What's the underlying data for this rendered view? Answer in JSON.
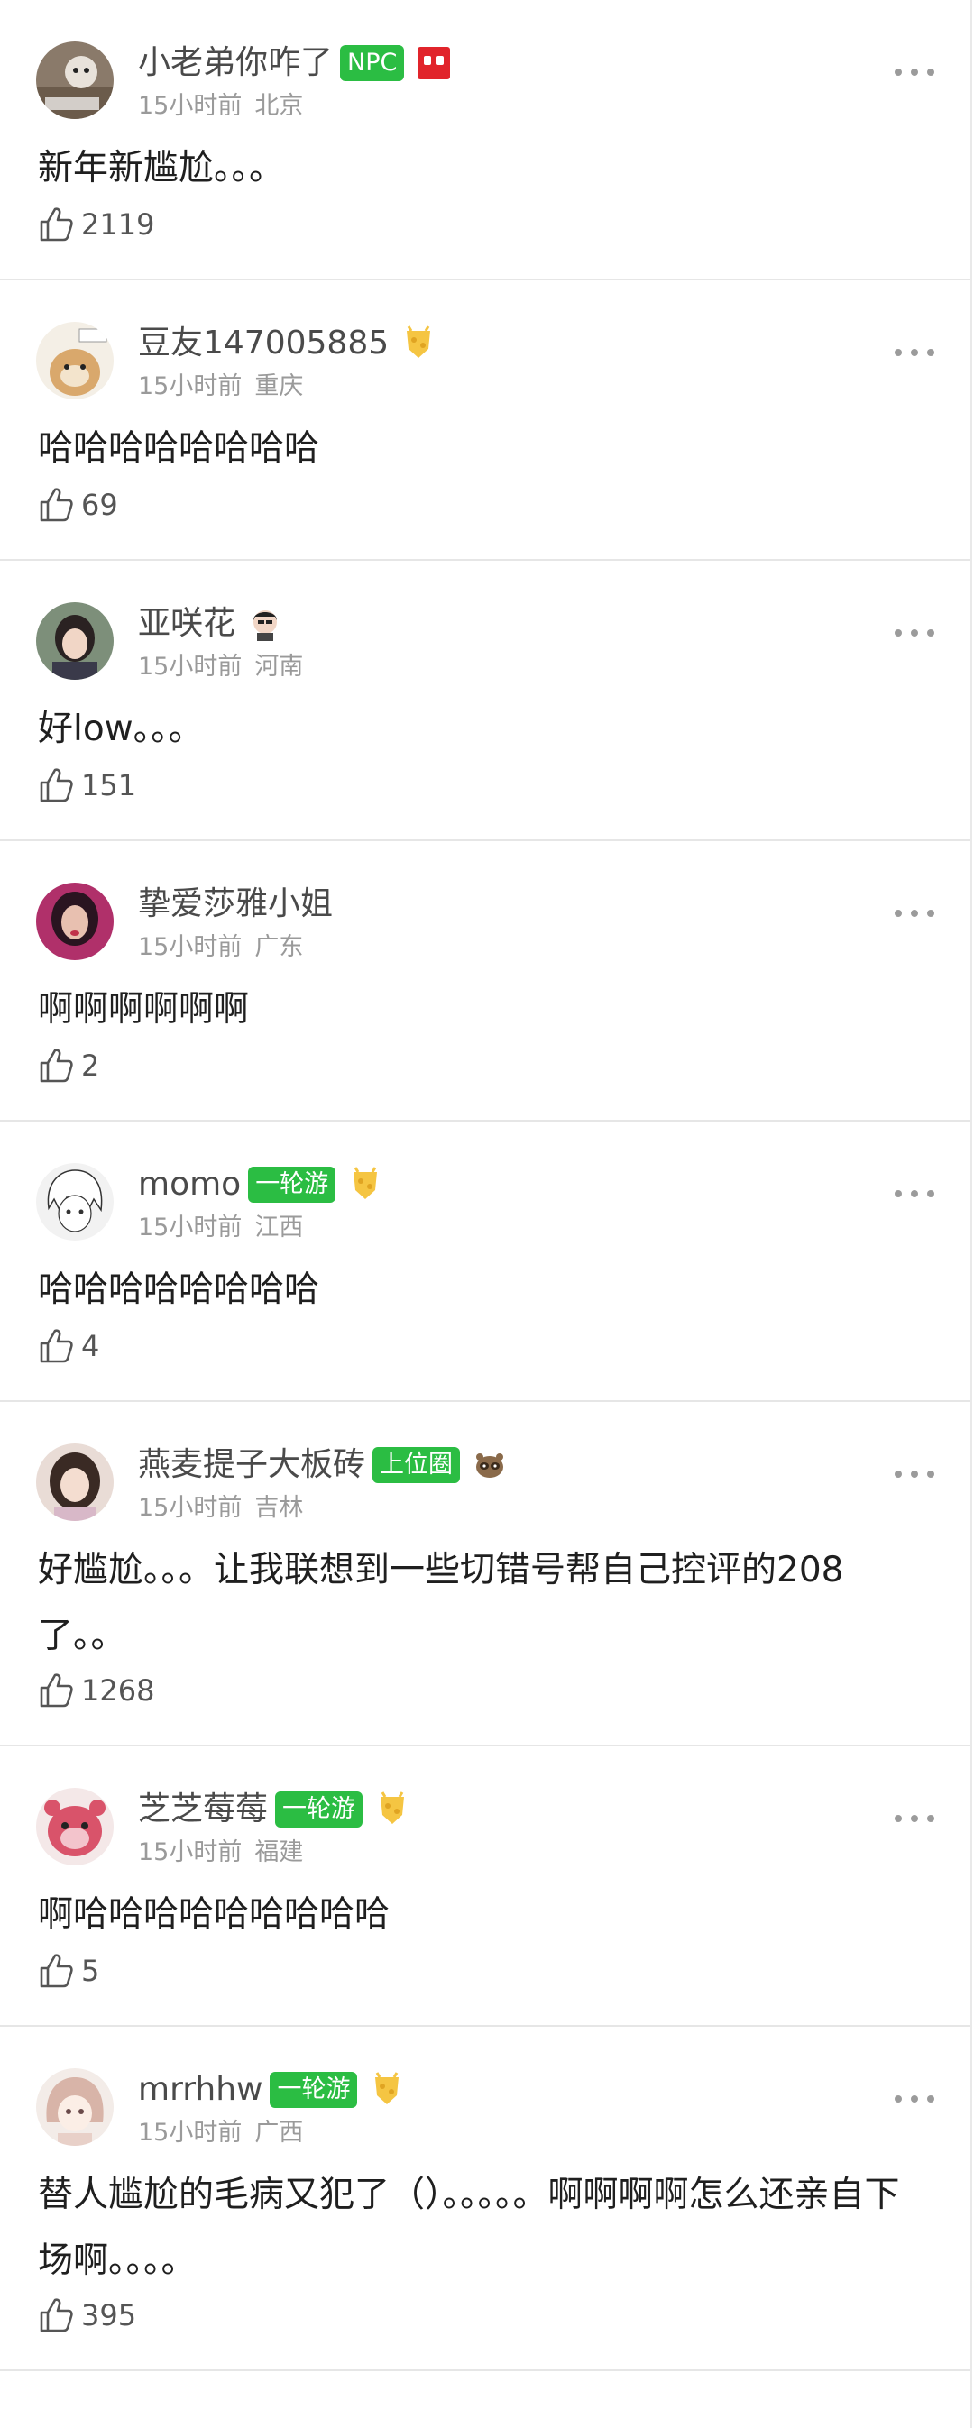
{
  "comments": [
    {
      "username": "小老弟你咋了",
      "badge": "NPC",
      "time": "15小时前",
      "location": "北京",
      "text": "新年新尴尬。。。",
      "likes": "2119",
      "badge_color": "#2bbd43"
    },
    {
      "username": "豆友147005885",
      "badge": "",
      "time": "15小时前",
      "location": "重庆",
      "text": "哈哈哈哈哈哈哈哈",
      "likes": "69"
    },
    {
      "username": "亚咲花",
      "badge": "",
      "time": "15小时前",
      "location": "河南",
      "text": "好low。。。",
      "likes": "151"
    },
    {
      "username": "挚爱莎雅小姐",
      "badge": "",
      "time": "15小时前",
      "location": "广东",
      "text": "啊啊啊啊啊啊",
      "likes": "2"
    },
    {
      "username": "momo",
      "badge": "一轮游",
      "time": "15小时前",
      "location": "江西",
      "text": "哈哈哈哈哈哈哈哈",
      "likes": "4"
    },
    {
      "username": "燕麦提子大板砖",
      "badge": "上位圈",
      "time": "15小时前",
      "location": "吉林",
      "text": "好尴尬。。。让我联想到一些切错号帮自己控评的208了。。",
      "likes": "1268"
    },
    {
      "username": "芝芝莓莓",
      "badge": "一轮游",
      "time": "15小时前",
      "location": "福建",
      "text": "啊哈哈哈哈哈哈哈哈哈",
      "likes": "5"
    },
    {
      "username": "mrrhhw",
      "badge": "一轮游",
      "time": "15小时前",
      "location": "广西",
      "text": "替人尴尬的毛病又犯了（）。。。。。啊啊啊啊怎么还亲自下场啊。。。。",
      "likes": "395"
    }
  ],
  "icons": {
    "more": "more-dots-icon",
    "like": "thumbs-up-icon",
    "medal": "cheese-medal-icon"
  },
  "colors": {
    "badge": "#2bbd43",
    "divider": "#e6e6e6",
    "meta": "#9a9a9a"
  }
}
